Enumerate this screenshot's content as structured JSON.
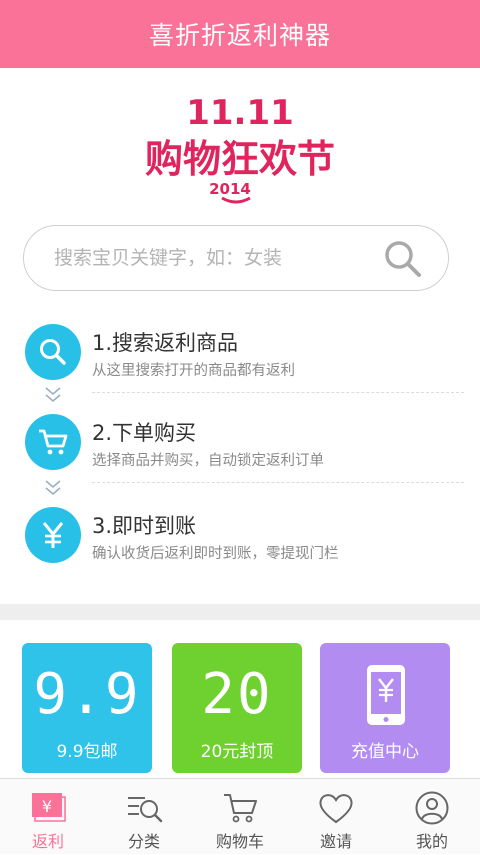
{
  "app": {
    "title": "喜折折返利神器"
  },
  "logo": {
    "text_top": "11.11",
    "text_main": "购物狂欢节",
    "text_year": "2014"
  },
  "search": {
    "placeholder": "搜索宝贝关键字，如：女装",
    "icon": "search-icon"
  },
  "steps": [
    {
      "title": "1.搜索返利商品",
      "desc": "从这里搜索打开的商品都有返利",
      "icon": "search-icon"
    },
    {
      "title": "2.下单购买",
      "desc": "选择商品并购买，自动锁定返利订单",
      "icon": "cart-icon"
    },
    {
      "title": "3.即时到账",
      "desc": "确认收货后返利即时到账，零提现门栏",
      "icon": "yen-icon"
    }
  ],
  "tiles": [
    {
      "big": "9.9",
      "label": "9.9包邮",
      "color": "#2fc3ea"
    },
    {
      "big": "20",
      "label": "20元封顶",
      "color": "#6fd12f"
    },
    {
      "big": "",
      "label": "充值中心",
      "color": "#b28cf0",
      "icon": "phone-yen-icon"
    }
  ],
  "tabs": [
    {
      "label": "返利",
      "icon": "rebate-icon",
      "active": true
    },
    {
      "label": "分类",
      "icon": "category-search-icon",
      "active": false
    },
    {
      "label": "购物车",
      "icon": "cart-icon",
      "active": false
    },
    {
      "label": "邀请",
      "icon": "heart-icon",
      "active": false
    },
    {
      "label": "我的",
      "icon": "user-icon",
      "active": false
    }
  ],
  "colors": {
    "brand": "#fb7299",
    "step_blue": "#29c0e8"
  }
}
